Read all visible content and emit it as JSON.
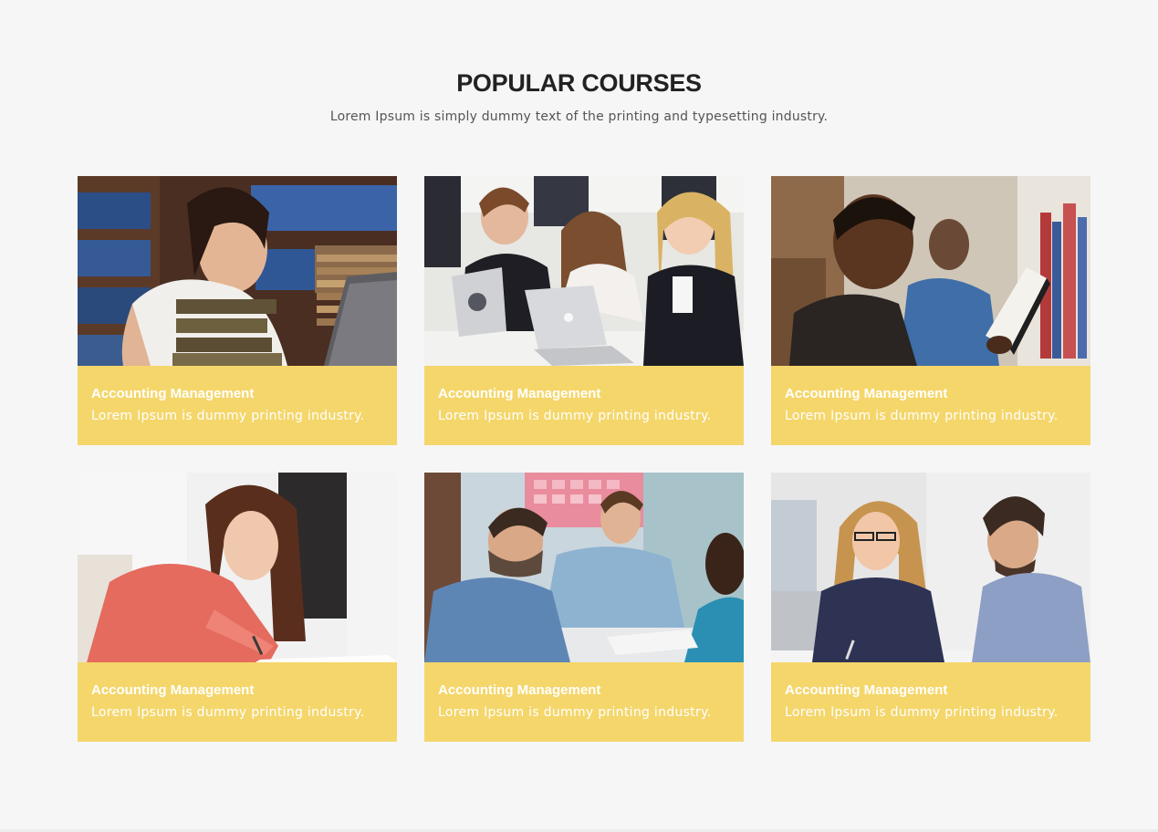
{
  "section": {
    "title": "POPULAR COURSES",
    "subtitle": "Lorem Ipsum is simply dummy text of the printing and typesetting industry."
  },
  "colors": {
    "page_background": "#f6f6f6",
    "card_caption_background": "#f4d66b",
    "caption_text": "#ffffff",
    "title_text": "#222222"
  },
  "courses": [
    {
      "title": "Accounting Management",
      "description": "Lorem Ipsum is dummy printing industry.",
      "image": "woman-with-laptop-and-books-in-library-photo"
    },
    {
      "title": "Accounting Management",
      "description": "Lorem Ipsum is dummy printing industry.",
      "image": "students-with-laptops-in-classroom-photo"
    },
    {
      "title": "Accounting Management",
      "description": "Lorem Ipsum is dummy printing industry.",
      "image": "student-reading-book-in-library-photo"
    },
    {
      "title": "Accounting Management",
      "description": "Lorem Ipsum is dummy printing industry.",
      "image": "woman-writing-at-desk-photo"
    },
    {
      "title": "Accounting Management",
      "description": "Lorem Ipsum is dummy printing industry.",
      "image": "group-study-discussion-photo"
    },
    {
      "title": "Accounting Management",
      "description": "Lorem Ipsum is dummy printing industry.",
      "image": "business-meeting-photo"
    }
  ]
}
